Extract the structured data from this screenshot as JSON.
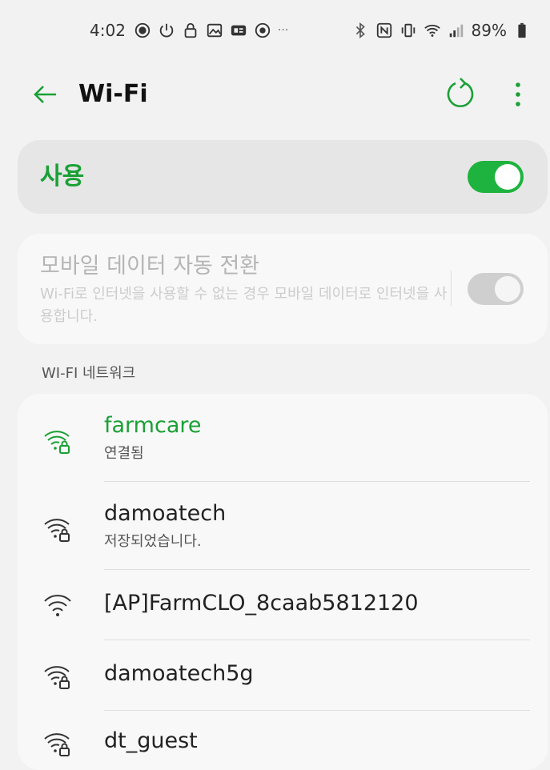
{
  "status_bar": {
    "time": "4:02",
    "overflow": "···",
    "battery": "89%",
    "left_icons": [
      "data-saver-icon",
      "power-icon",
      "lock-icon",
      "image-icon",
      "ge-app-icon",
      "android-icon"
    ],
    "right_icons": [
      "bluetooth-icon",
      "nfc-icon",
      "vibrate-icon",
      "wifi-status-icon",
      "signal-icon",
      "battery-icon"
    ]
  },
  "app_bar": {
    "title": "Wi-Fi"
  },
  "wifi_toggle": {
    "label": "사용",
    "on": true
  },
  "mobile_data_switch": {
    "label": "모바일 데이터 자동 전환",
    "description": "Wi-Fi로 인터넷을 사용할 수 없는 경우 모바일 데이터로 인터넷을 사용합니다.",
    "on": true,
    "enabled": false
  },
  "networks_section": {
    "header": "WI-FI 네트워크",
    "items": [
      {
        "name": "farmcare",
        "status": "연결됨",
        "secured": true,
        "connected": true
      },
      {
        "name": "damoatech",
        "status": "저장되었습니다.",
        "secured": true,
        "connected": false
      },
      {
        "name": "[AP]FarmCLO_8caab5812120",
        "secured": false,
        "connected": false
      },
      {
        "name": "damoatech5g",
        "secured": true,
        "connected": false
      },
      {
        "name": "dt_guest",
        "secured": true,
        "connected": false
      }
    ]
  },
  "colors": {
    "accent": "#1aa035",
    "toggle_on": "#1db33e",
    "background": "#f2f2f2"
  }
}
